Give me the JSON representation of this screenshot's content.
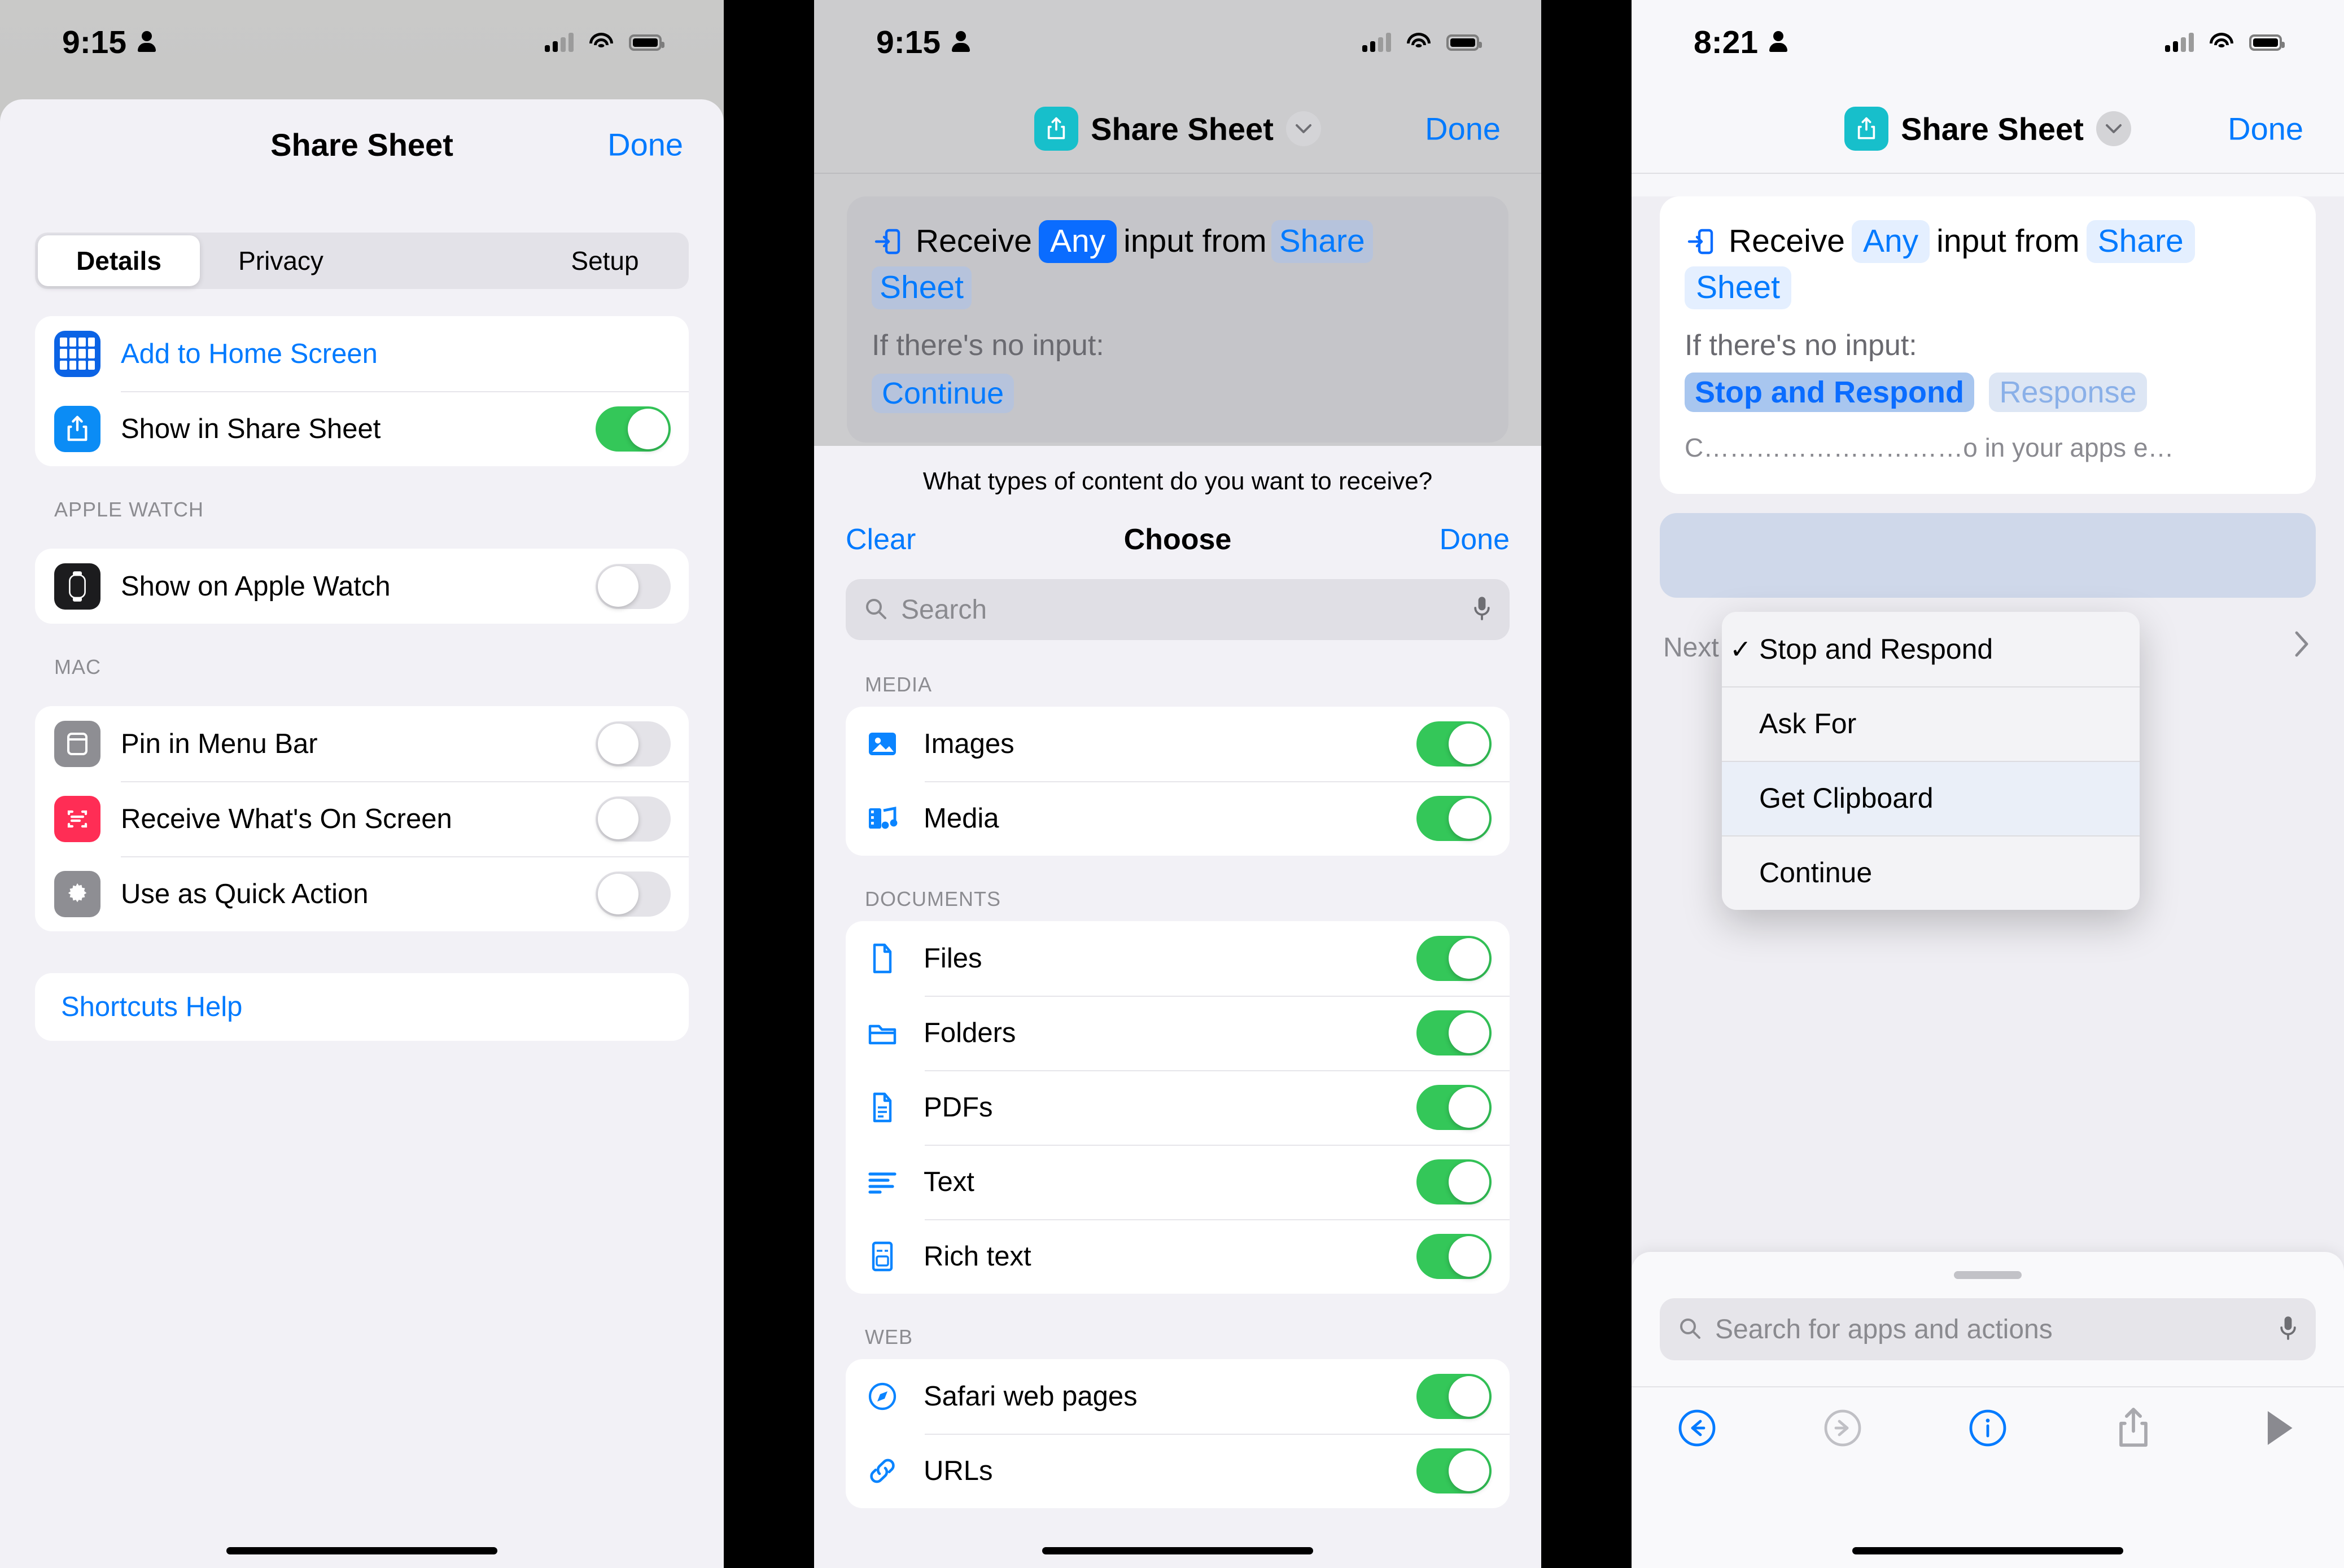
{
  "panel1": {
    "status": {
      "time": "9:15",
      "person_icon": "person-icon",
      "signal_icon": "cellular-signal-icon",
      "wifi_icon": "wifi-icon",
      "battery_icon": "battery-icon"
    },
    "nav": {
      "title": "Share Sheet",
      "done_label": "Done"
    },
    "tabs": [
      {
        "label": "Details",
        "active": true
      },
      {
        "label": "Privacy",
        "active": false
      },
      {
        "label": "Setup",
        "active": false
      }
    ],
    "group_main": [
      {
        "label": "Add to Home Screen",
        "icon": "home-screen-grid-icon",
        "style": "link",
        "toggle": null
      },
      {
        "label": "Show in Share Sheet",
        "icon": "share-icon",
        "style": "plain",
        "toggle": "on"
      }
    ],
    "section_watch_header": "APPLE WATCH",
    "group_watch": [
      {
        "label": "Show on Apple Watch",
        "icon": "apple-watch-icon",
        "toggle": "off"
      }
    ],
    "section_mac_header": "MAC",
    "group_mac": [
      {
        "label": "Pin in Menu Bar",
        "icon": "menu-bar-icon",
        "toggle": "off"
      },
      {
        "label": "Receive What's On Screen",
        "icon": "screen-capture-icon",
        "toggle": "off"
      },
      {
        "label": "Use as Quick Action",
        "icon": "gear-icon",
        "toggle": "off"
      }
    ],
    "help_link": "Shortcuts Help"
  },
  "panel2": {
    "status": {
      "time": "9:15"
    },
    "nav": {
      "title": "Share Sheet",
      "done_label": "Done",
      "app_icon": "share-sheet-icon",
      "chevron": "chevron-down-icon"
    },
    "action": {
      "icon": "receive-input-icon",
      "word_receive": "Receive",
      "token_any": "Any",
      "word_input_from": "input from",
      "token_source_a": "Share",
      "token_source_b": "Sheet",
      "no_input_label": "If there's no input:",
      "no_input_value": "Continue"
    },
    "picker": {
      "prompt": "What types of content do you want to receive?",
      "clear_label": "Clear",
      "title": "Choose",
      "done_label": "Done",
      "search_placeholder": "Search",
      "mic_icon": "microphone-icon",
      "search_icon": "search-icon",
      "sections": [
        {
          "header": "MEDIA",
          "items": [
            {
              "label": "Images",
              "icon": "photo-icon",
              "toggle": "on"
            },
            {
              "label": "Media",
              "icon": "media-icon",
              "toggle": "on"
            }
          ]
        },
        {
          "header": "DOCUMENTS",
          "items": [
            {
              "label": "Files",
              "icon": "file-icon",
              "toggle": "on"
            },
            {
              "label": "Folders",
              "icon": "folder-icon",
              "toggle": "on"
            },
            {
              "label": "PDFs",
              "icon": "pdf-icon",
              "toggle": "on"
            },
            {
              "label": "Text",
              "icon": "text-icon",
              "toggle": "on"
            },
            {
              "label": "Rich text",
              "icon": "rich-text-icon",
              "toggle": "on"
            }
          ]
        },
        {
          "header": "WEB",
          "items": [
            {
              "label": "Safari web pages",
              "icon": "safari-icon",
              "toggle": "on"
            },
            {
              "label": "URLs",
              "icon": "link-icon",
              "toggle": "on"
            }
          ]
        }
      ]
    }
  },
  "panel3": {
    "status": {
      "time": "8:21"
    },
    "nav": {
      "title": "Share Sheet",
      "done_label": "Done",
      "app_icon": "share-sheet-icon",
      "chevron": "chevron-down-icon"
    },
    "action": {
      "icon": "receive-input-icon",
      "word_receive": "Receive",
      "token_any": "Any",
      "word_input_from": "input from",
      "token_source_a": "Share",
      "token_source_b": "Sheet",
      "no_input_label": "If there's no input:",
      "selected_value": "Stop and Respond",
      "response_token": "Response",
      "description": "C…………………………o in your apps e…"
    },
    "menu": {
      "items": [
        {
          "label": "Stop and Respond",
          "checked": true,
          "highlighted": false
        },
        {
          "label": "Ask For",
          "checked": false,
          "highlighted": false
        },
        {
          "label": "Get Clipboard",
          "checked": false,
          "highlighted": true
        },
        {
          "label": "Continue",
          "checked": false,
          "highlighted": false
        }
      ],
      "check_glyph": "✓"
    },
    "next_action_suggestions": {
      "label": "Next Action Suggestions",
      "chevron": "chevron-right-icon"
    },
    "bottom": {
      "search_placeholder": "Search for apps and actions",
      "search_icon": "search-icon",
      "mic_icon": "microphone-icon",
      "toolbar": [
        {
          "name": "undo-icon",
          "state": "enabled"
        },
        {
          "name": "redo-icon",
          "state": "disabled"
        },
        {
          "name": "info-icon",
          "state": "enabled"
        },
        {
          "name": "share-icon",
          "state": "enabled"
        },
        {
          "name": "play-icon",
          "state": "enabled"
        }
      ]
    }
  },
  "colors": {
    "accent_blue": "#007aff",
    "toggle_green": "#34c759",
    "app_teal": "#17bfcb",
    "red": "#ff2d55",
    "grey": "#8e8e93"
  }
}
